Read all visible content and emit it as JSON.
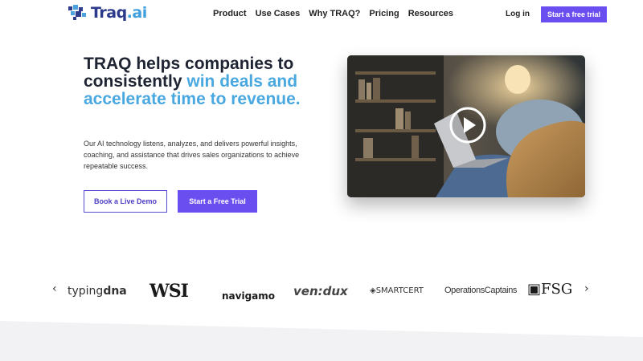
{
  "brand": {
    "logo_main": "Traq",
    "logo_accent": ".ai",
    "color_primary": "#6b4ef0",
    "color_accent": "#4aa8e0"
  },
  "nav": {
    "items": [
      {
        "label": "Product"
      },
      {
        "label": "Use Cases"
      },
      {
        "label": "Why TRAQ?"
      },
      {
        "label": "Pricing"
      },
      {
        "label": "Resources"
      }
    ],
    "login": "Log in",
    "cta": "Start a free trial"
  },
  "hero": {
    "headline_plain": "TRAQ helps companies to consistently ",
    "headline_highlight": "win deals and accelerate time to revenue.",
    "subtext": "Our AI technology listens, analyzes, and delivers powerful insights, coaching, and assistance that drives sales organizations to achieve repeatable success.",
    "primary_button": "Book a Live Demo",
    "secondary_button": "Start a Free Trial",
    "video_icon": "play-icon"
  },
  "logos": {
    "prev_icon": "chevron-left-icon",
    "next_icon": "chevron-right-icon",
    "items": {
      "typing_a": "typing",
      "typing_b": "dna",
      "wsi": "WSI",
      "navigamo": "navigamo",
      "vendux": "ven:dux",
      "smartcert": "SMARTCERT",
      "operations": "OperationsCaptains",
      "fsg": "FSG"
    }
  }
}
